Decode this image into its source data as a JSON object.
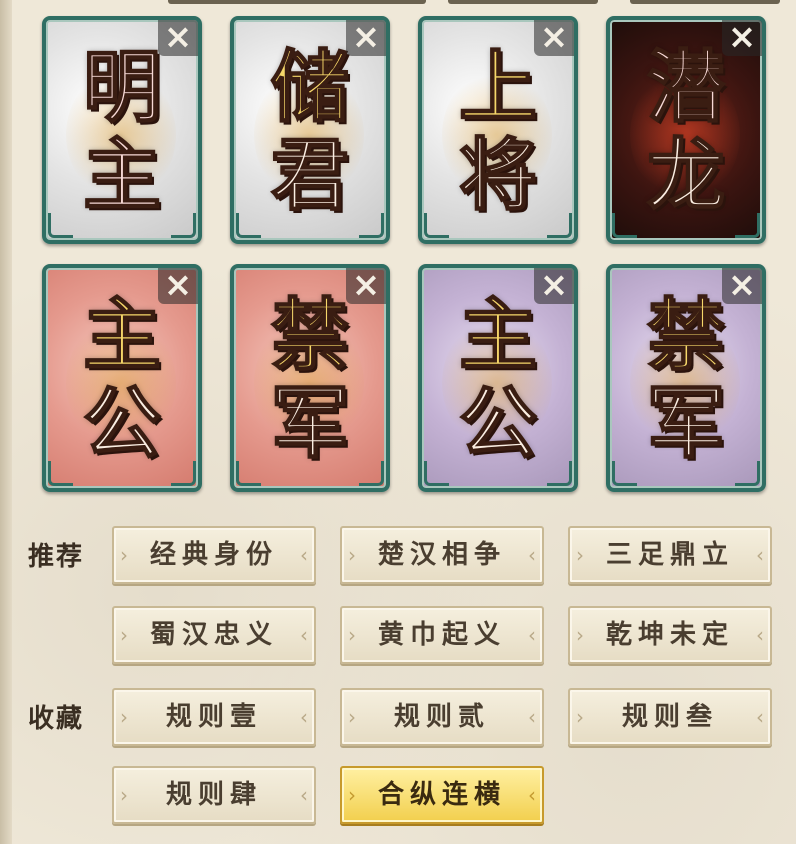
{
  "cards_row1": [
    {
      "top": "明",
      "bottom": "主",
      "theme": "white",
      "text_color": "pink"
    },
    {
      "top": "储",
      "bottom": "君",
      "theme": "white",
      "text_color": "gold"
    },
    {
      "top": "上",
      "bottom": "将",
      "theme": "white",
      "text_color": "gold"
    },
    {
      "top": "潜",
      "bottom": "龙",
      "theme": "dark",
      "text_color": "cream"
    }
  ],
  "cards_row2": [
    {
      "top": "主",
      "bottom": "公",
      "theme": "red",
      "text_color": "gold"
    },
    {
      "top": "禁",
      "bottom": "军",
      "theme": "red",
      "text_color": "cream"
    },
    {
      "top": "主",
      "bottom": "公",
      "theme": "purple",
      "text_color": "gold"
    },
    {
      "top": "禁",
      "bottom": "军",
      "theme": "purple",
      "text_color": "gold"
    }
  ],
  "close_icon": "×",
  "recommend": {
    "label": "推荐",
    "items": [
      "经典身份",
      "楚汉相争",
      "三足鼎立",
      "蜀汉忠义",
      "黄巾起义",
      "乾坤未定"
    ]
  },
  "favorites": {
    "label": "收藏",
    "items": [
      "规则壹",
      "规则贰",
      "规则叁",
      "规则肆",
      "合纵连横"
    ],
    "active_index": 4
  },
  "colors": {
    "card_border": "#2f6e63",
    "button_bg": "#efe6d0",
    "button_active_bg": "#f2cf4d",
    "page_bg": "#efe8d8"
  }
}
